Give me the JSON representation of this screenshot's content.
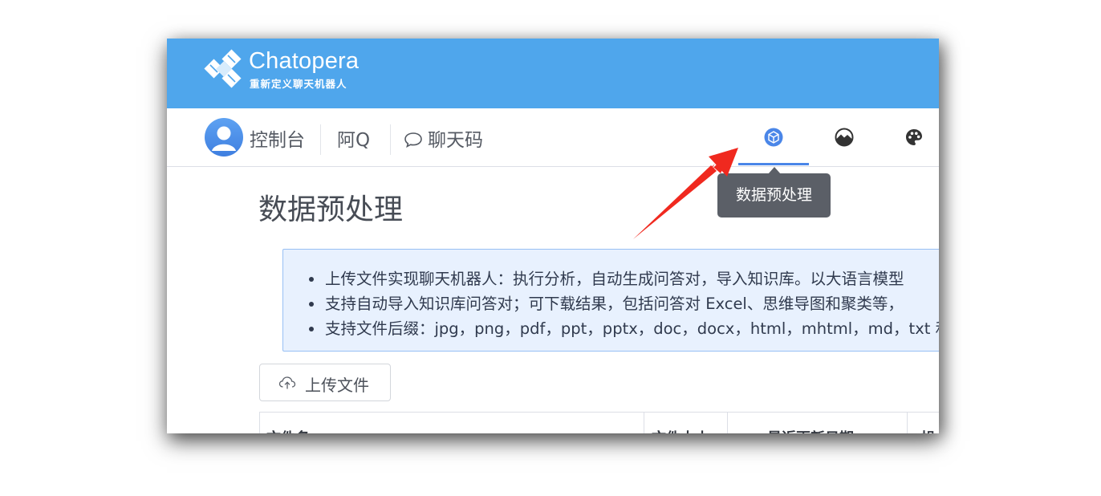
{
  "header": {
    "brand_name": "Chatopera",
    "tagline": "重新定义聊天机器人"
  },
  "nav": {
    "console_label": "控制台",
    "aq_label": "阿Q",
    "chatcode_label": "聊天码",
    "tab_icons": [
      "data-preprocess-icon",
      "landscape-icon",
      "palette-icon"
    ]
  },
  "tooltip": {
    "text": "数据预处理"
  },
  "page": {
    "title": "数据预处理",
    "info_items": [
      "上传文件实现聊天机器人：执行分析，自动生成问答对，导入知识库。以大语言模型",
      "支持自动导入知识库问答对；可下载结果，包括问答对 Excel、思维导图和聚类等，",
      "支持文件后缀：jpg，png，pdf，ppt，pptx，doc，docx，html，mhtml，md，txt 和"
    ],
    "upload_button": "上传文件"
  },
  "table": {
    "columns": [
      "文件名",
      "文件大小",
      "最近更新日期",
      "操"
    ]
  },
  "colors": {
    "header_bg": "#4fa6ec",
    "accent": "#4a86e8",
    "tooltip_bg": "#5b5f67",
    "info_bg": "#e8f1fe",
    "annotation_arrow": "#f0291f"
  }
}
